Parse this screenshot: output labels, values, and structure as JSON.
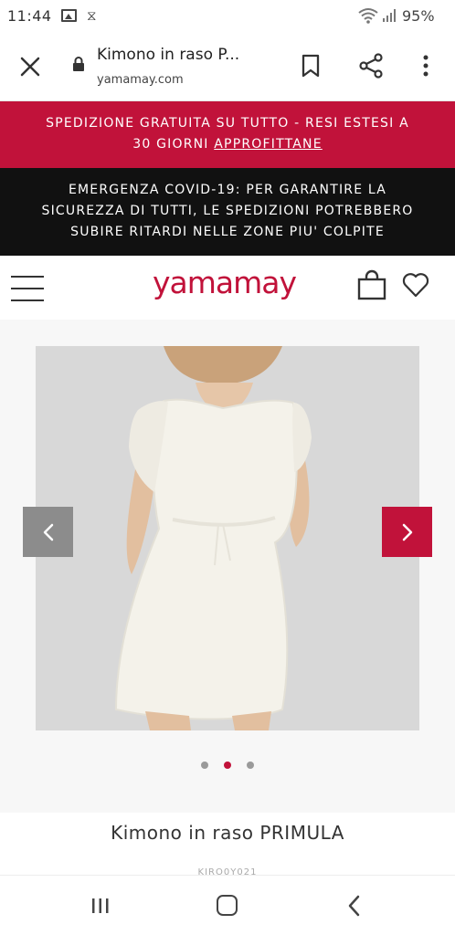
{
  "status_bar": {
    "time": "11:44",
    "battery": "95%",
    "icons": [
      "gallery-icon",
      "hourglass-icon",
      "wifi-icon",
      "signal-icon"
    ]
  },
  "browser": {
    "page_title": "Kimono in raso P...",
    "url": "yamamay.com",
    "icons": [
      "close-icon",
      "lock-icon",
      "bookmark-icon",
      "share-icon",
      "more-vert-icon"
    ]
  },
  "promo_banner": {
    "line1": "SPEDIZIONE GRATUITA SU TUTTO - RESI ESTESI A",
    "line2_prefix": "30 GIORNI ",
    "link": "APPROFITTANE",
    "bg_color": "#c1123a"
  },
  "covid_banner": {
    "line1": "EMERGENZA COVID-19: PER GARANTIRE LA",
    "line2": "SICUREZZA DI TUTTI, LE SPEDIZIONI POTREBBERO",
    "line3": "SUBIRE RITARDI NELLE ZONE PIU' COLPITE"
  },
  "header": {
    "logo": "yamamay",
    "icons": [
      "menu-icon",
      "shopping-bag-icon",
      "heart-icon"
    ]
  },
  "gallery": {
    "image_count": 3,
    "active_index": 1,
    "prev_icon": "chevron-left-icon",
    "next_icon": "chevron-right-icon"
  },
  "product": {
    "name": "Kimono in raso PRIMULA",
    "sku": "KIRO0Y021"
  },
  "nav_bar": {
    "icons": [
      "recent-apps-icon",
      "home-icon",
      "back-icon"
    ]
  },
  "colors": {
    "brand_red": "#c1123a",
    "dark_banner": "#111111"
  }
}
